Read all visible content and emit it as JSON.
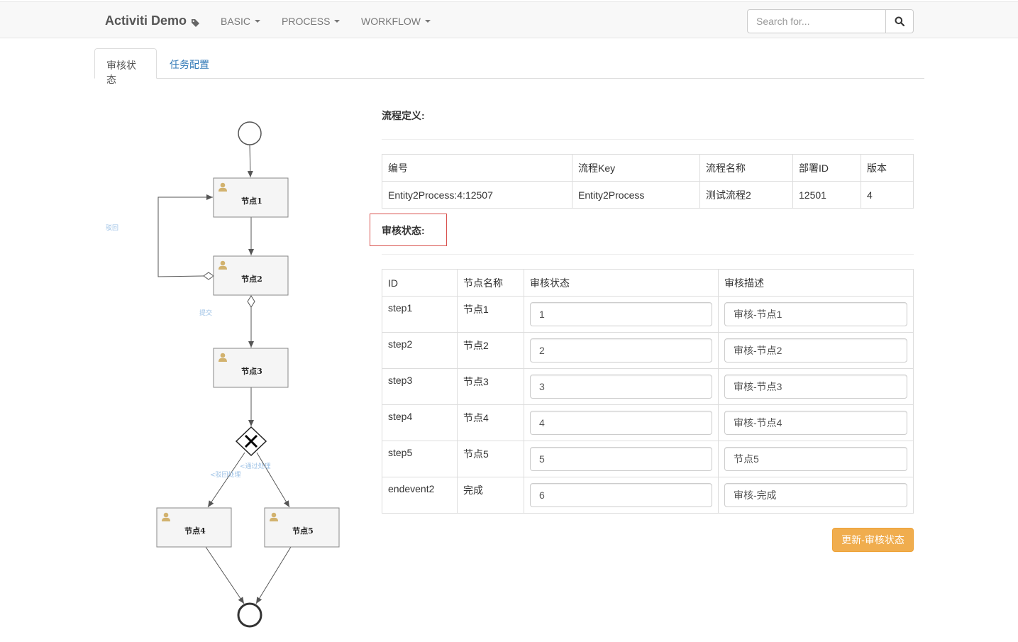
{
  "navbar": {
    "brand": "Activiti Demo",
    "menus": [
      "BASIC",
      "PROCESS",
      "WORKFLOW"
    ],
    "search_placeholder": "Search for..."
  },
  "tabs": [
    "审核状态",
    "任务配置"
  ],
  "diagram": {
    "nodes": [
      "节点1",
      "节点2",
      "节点3",
      "节点4",
      "节点5"
    ],
    "flow_labels": {
      "reject": "驳回",
      "submit": "提交",
      "left_branch": "<驳回处理",
      "right_branch": "<通过处理"
    }
  },
  "definition": {
    "title": "流程定义:",
    "headers": [
      "编号",
      "流程Key",
      "流程名称",
      "部署ID",
      "版本"
    ],
    "row": [
      "Entity2Process:4:12507",
      "Entity2Process",
      "测试流程2",
      "12501",
      "4"
    ]
  },
  "audit": {
    "title": "审核状态:",
    "headers": [
      "ID",
      "节点名称",
      "审核状态",
      "审核描述"
    ],
    "rows": [
      {
        "id": "step1",
        "name": "节点1",
        "status": "1",
        "desc": "审核-节点1"
      },
      {
        "id": "step2",
        "name": "节点2",
        "status": "2",
        "desc": "审核-节点2"
      },
      {
        "id": "step3",
        "name": "节点3",
        "status": "3",
        "desc": "审核-节点3"
      },
      {
        "id": "step4",
        "name": "节点4",
        "status": "4",
        "desc": "审核-节点4"
      },
      {
        "id": "step5",
        "name": "节点5",
        "status": "5",
        "desc": "节点5"
      },
      {
        "id": "endevent2",
        "name": "完成",
        "status": "6",
        "desc": "审核-完成"
      }
    ],
    "update_button": "更新-审核状态"
  }
}
